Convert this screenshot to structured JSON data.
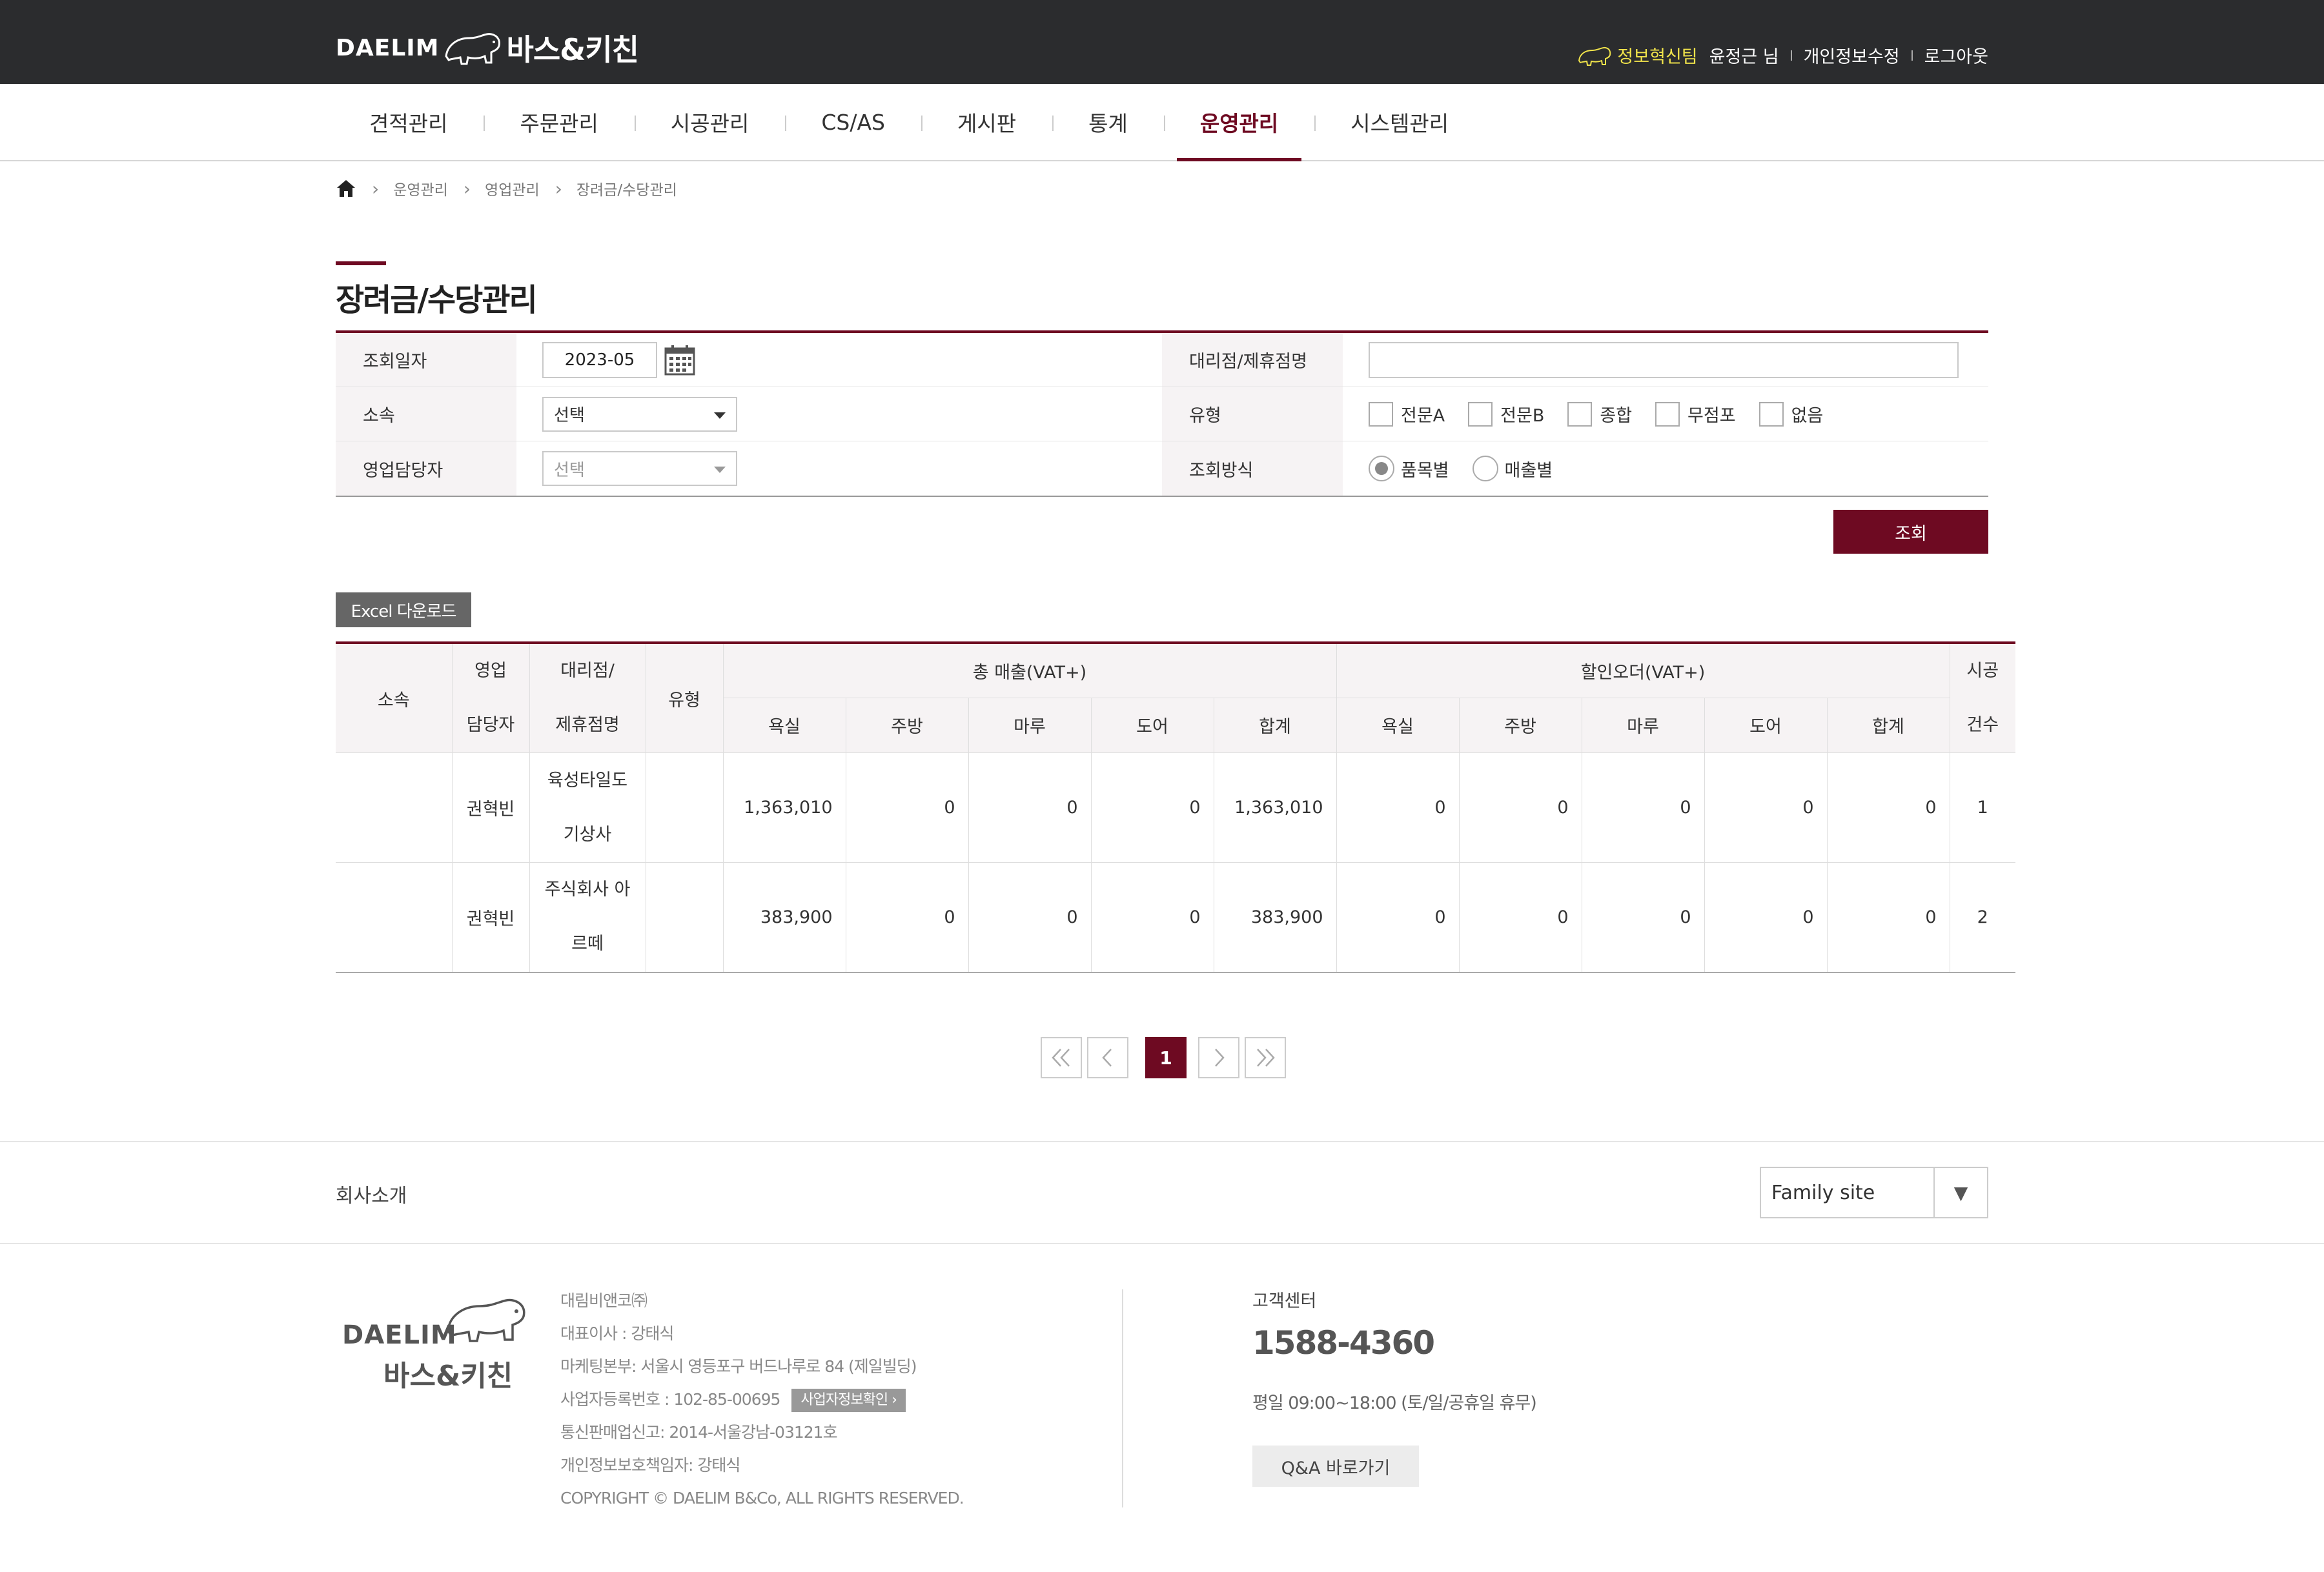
{
  "header": {
    "logo_en": "DAELIM",
    "logo_kr": "바스&키친",
    "team": "정보혁신팀",
    "user_name": "윤정근 님",
    "edit_profile": "개인정보수정",
    "logout": "로그아웃"
  },
  "nav": {
    "items": [
      {
        "label": "견적관리"
      },
      {
        "label": "주문관리"
      },
      {
        "label": "시공관리"
      },
      {
        "label": "CS/AS"
      },
      {
        "label": "게시판"
      },
      {
        "label": "통계"
      },
      {
        "label": "운영관리",
        "active": true
      },
      {
        "label": "시스템관리"
      }
    ]
  },
  "breadcrumb": [
    "운영관리",
    "영업관리",
    "장려금/수당관리"
  ],
  "page_title": "장려금/수당관리",
  "search": {
    "date_label": "조회일자",
    "date_value": "2023-05",
    "dealer_label": "대리점/제휴점명",
    "dealer_value": "",
    "affil_label": "소속",
    "affil_value": "선택",
    "type_label": "유형",
    "type_options": [
      "전문A",
      "전문B",
      "종합",
      "무점포",
      "없음"
    ],
    "sales_label": "영업담당자",
    "sales_value": "선택",
    "method_label": "조회방식",
    "method_options": [
      "품목별",
      "매출별"
    ],
    "method_selected": "품목별",
    "search_button": "조회"
  },
  "excel_button": "Excel 다운로드",
  "table": {
    "h_affil": "소속",
    "h_sales_1": "영업",
    "h_sales_2": "담당자",
    "h_dealer_1": "대리점/",
    "h_dealer_2": "제휴점명",
    "h_type": "유형",
    "h_total": "총 매출(VAT+)",
    "h_discount": "할인오더(VAT+)",
    "h_count_1": "시공",
    "h_count_2": "건수",
    "sub": [
      "욕실",
      "주방",
      "마루",
      "도어",
      "합계"
    ],
    "rows": [
      {
        "affil": "",
        "sales": "권혁빈",
        "dealer_1": "육성타일도",
        "dealer_2": "기상사",
        "type": "",
        "total": [
          "1,363,010",
          "0",
          "0",
          "0",
          "1,363,010"
        ],
        "discount": [
          "0",
          "0",
          "0",
          "0",
          "0"
        ],
        "count": "1"
      },
      {
        "affil": "",
        "sales": "권혁빈",
        "dealer_1": "주식회사 아",
        "dealer_2": "르떼",
        "type": "",
        "total": [
          "383,900",
          "0",
          "0",
          "0",
          "383,900"
        ],
        "discount": [
          "0",
          "0",
          "0",
          "0",
          "0"
        ],
        "count": "2"
      }
    ]
  },
  "pagination": {
    "current": "1"
  },
  "footer": {
    "company_intro": "회사소개",
    "family_site": "Family site",
    "logo_en": "DAELIM",
    "logo_kr": "바스&키친",
    "company": "대림비앤코㈜",
    "ceo": "대표이사 : 강태식",
    "marketing": "마케팅본부: 서울시 영등포구 버드나루로 84 (제일빌딩)",
    "biz_no": "사업자등록번호 : 102-85-00695",
    "biz_check": "사업자정보확인",
    "telecom": "통신판매업신고: 2014-서울강남-03121호",
    "privacy": "개인정보보호책임자: 강태식",
    "copyright": "COPYRIGHT © DAELIM B&Co, ALL RIGHTS RESERVED.",
    "cs_label": "고객센터",
    "cs_phone": "1588-4360",
    "cs_hours": "평일 09:00~18:00 (토/일/공휴일 휴무)",
    "qna_button": "Q&A 바로가기"
  }
}
